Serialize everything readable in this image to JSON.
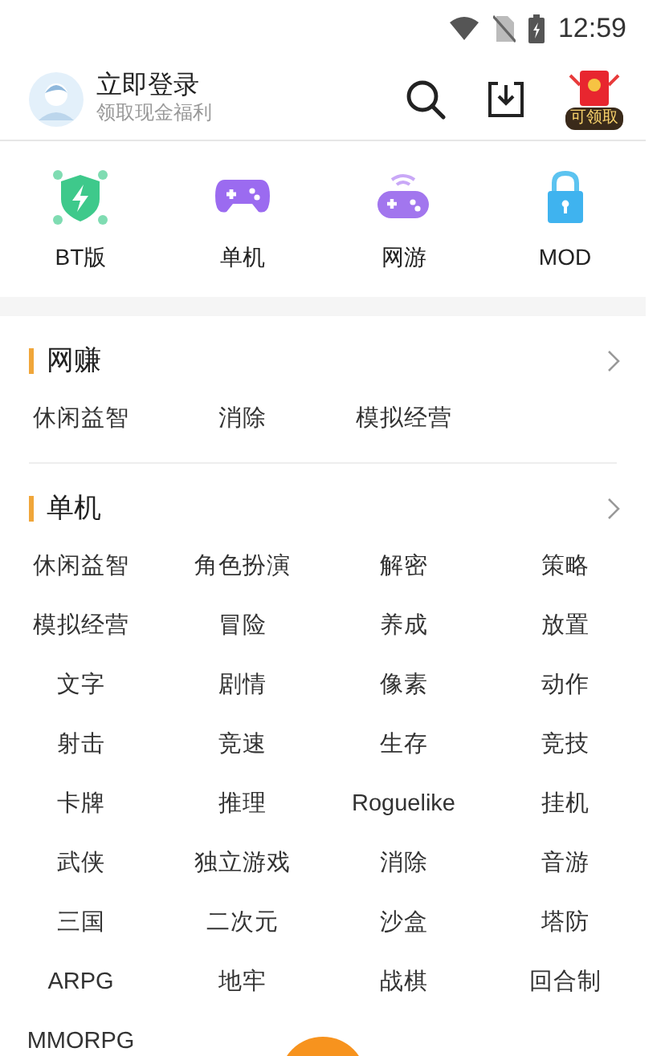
{
  "status_bar": {
    "time": "12:59"
  },
  "header": {
    "title": "立即登录",
    "subtitle": "领取现金福利",
    "reward_badge": "可领取"
  },
  "categories": [
    {
      "label": "BT版",
      "kind": "bt"
    },
    {
      "label": "单机",
      "kind": "single"
    },
    {
      "label": "网游",
      "kind": "online"
    },
    {
      "label": "MOD",
      "kind": "mod"
    }
  ],
  "sections": [
    {
      "title": "网赚",
      "tags": [
        "休闲益智",
        "消除",
        "模拟经营"
      ]
    },
    {
      "title": "单机",
      "tags": [
        "休闲益智",
        "角色扮演",
        "解密",
        "策略",
        "模拟经营",
        "冒险",
        "养成",
        "放置",
        "文字",
        "剧情",
        "像素",
        "动作",
        "射击",
        "竞速",
        "生存",
        "竞技",
        "卡牌",
        "推理",
        "Roguelike",
        "挂机",
        "武侠",
        "独立游戏",
        "消除",
        "音游",
        "三国",
        "二次元",
        "沙盒",
        "塔防",
        "ARPG",
        "地牢",
        "战棋",
        "回合制",
        "MMORPG"
      ]
    }
  ]
}
